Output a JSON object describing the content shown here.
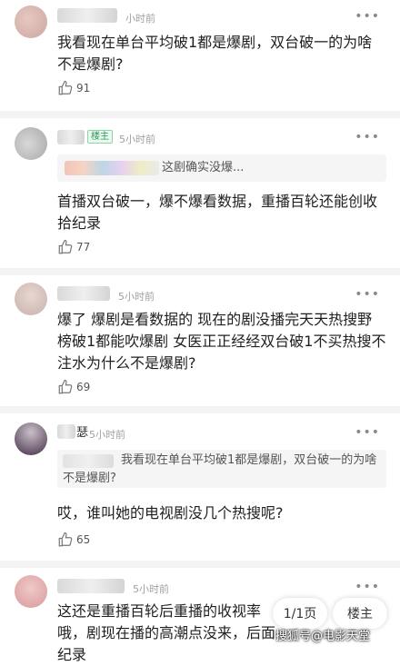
{
  "comments": [
    {
      "time": "小时前",
      "text": "我看现在单台平均破1都是爆剧，双台破一的为啥不是爆剧?",
      "likes": "91",
      "more": "•••"
    },
    {
      "badge": "楼主",
      "time": "5小时前",
      "quote": "这剧确实没爆...",
      "text": "首播双台破一，爆不爆看数据，重播百轮还能创收拾纪录",
      "likes": "77",
      "more": "•••"
    },
    {
      "time": "5小时前",
      "text": "爆了 爆剧是看数据的 现在的剧没播完天天热搜野榜破1都能吹爆剧 女医正正经经双台破1不买热搜不注水为什么不是爆剧?",
      "likes": "69",
      "more": "•••"
    },
    {
      "name_fragment": "瑟",
      "time": "5小时前",
      "quote": "我看现在单台平均破1都是爆剧，双台破一的为啥不是爆剧?",
      "text": "哎，谁叫她的电视剧没几个热搜呢?",
      "likes": "65",
      "more": "•••"
    },
    {
      "time": "5小时前",
      "text": "这还是重播百轮后重播的收视率哦，剧现在播的高潮点没来，后面纪录",
      "more": "•••"
    }
  ],
  "pager": {
    "label": "1/1页"
  },
  "owner_button": {
    "label": "楼主"
  },
  "watermark": "搜狐号@电影天堂",
  "icons": {
    "like": "thumbs-up-icon",
    "more": "more-dots-icon"
  }
}
